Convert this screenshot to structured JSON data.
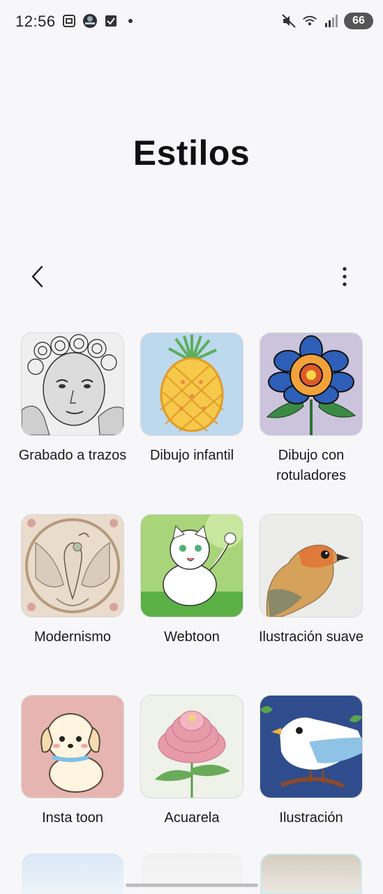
{
  "status_bar": {
    "time": "12:56",
    "battery": "66"
  },
  "page": {
    "title": "Estilos"
  },
  "styles": [
    {
      "label": "Grabado a trazos"
    },
    {
      "label": "Dibujo infantil"
    },
    {
      "label": "Dibujo con rotuladores"
    },
    {
      "label": "Modernismo"
    },
    {
      "label": "Webtoon"
    },
    {
      "label": "Ilustración suave"
    },
    {
      "label": "Insta toon"
    },
    {
      "label": "Acuarela"
    },
    {
      "label": "Ilustración"
    }
  ],
  "colors": {
    "background": "#f7f7f9",
    "text": "#111111"
  }
}
